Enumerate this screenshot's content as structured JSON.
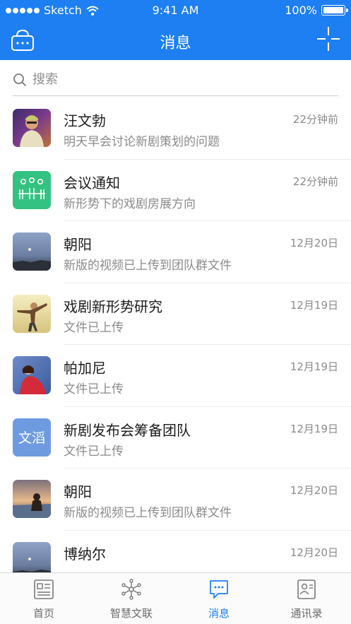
{
  "status_bar": {
    "carrier": "Sketch",
    "time": "9:41 AM",
    "battery": "100%"
  },
  "nav": {
    "title": "消息",
    "left_icon": "briefcase-icon",
    "right_icon": "scan-icon"
  },
  "search": {
    "placeholder": "搜索"
  },
  "messages": [
    {
      "name": "汪文勃",
      "preview": "明天早会讨论新剧策划的问题",
      "time": "22分钟前",
      "avatar": "photo-man"
    },
    {
      "name": "会议通知",
      "preview": "新形势下的戏剧房展方向",
      "time": "22分钟前",
      "avatar": "meeting-icon"
    },
    {
      "name": "朝阳",
      "preview": "新版的视频已上传到团队群文件",
      "time": "12月20日",
      "avatar": "photo-moon"
    },
    {
      "name": "戏剧新形势研究",
      "preview": "文件已上传",
      "time": "12月19日",
      "avatar": "photo-girl-yellow"
    },
    {
      "name": "帕加尼",
      "preview": "文件已上传",
      "time": "12月19日",
      "avatar": "photo-girl-red"
    },
    {
      "name": "新剧发布会筹备团队",
      "preview": "文件已上传",
      "time": "12月19日",
      "avatar_text": "文滔"
    },
    {
      "name": "朝阳",
      "preview": "新版的视频已上传到团队群文件",
      "time": "12月20日",
      "avatar": "photo-sunset"
    },
    {
      "name": "博纳尔",
      "preview": "",
      "time": "12月20日",
      "avatar": "photo-moon"
    }
  ],
  "tabs": [
    {
      "label": "首页",
      "icon": "home-card-icon",
      "active": false
    },
    {
      "label": "智慧文联",
      "icon": "network-icon",
      "active": false
    },
    {
      "label": "消息",
      "icon": "chat-icon",
      "active": true
    },
    {
      "label": "通讯录",
      "icon": "contacts-icon",
      "active": false
    }
  ],
  "colors": {
    "primary": "#1d7ff2",
    "meeting_green": "#33c281",
    "text_avatar": "#6e9ae0"
  }
}
